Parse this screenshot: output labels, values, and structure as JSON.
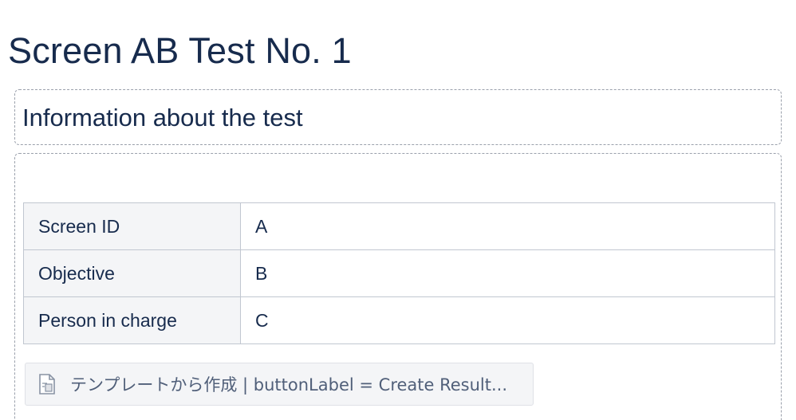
{
  "page": {
    "title": "Screen AB Test No. 1"
  },
  "section": {
    "heading": "Information about the test"
  },
  "info_table": {
    "rows": [
      {
        "label": "Screen ID",
        "value": "A"
      },
      {
        "label": "Objective",
        "value": "B"
      },
      {
        "label": "Person in charge",
        "value": "C"
      }
    ]
  },
  "template_button": {
    "icon": "document-template-icon",
    "label": "テンプレートから作成 | buttonLabel = Create Result..."
  }
}
